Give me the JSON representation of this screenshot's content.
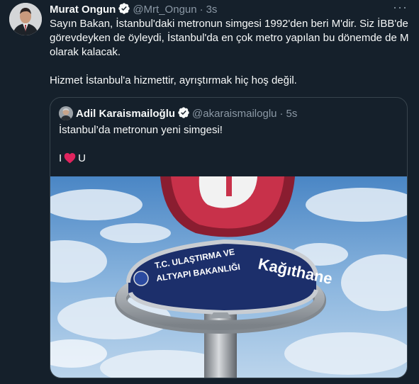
{
  "tweet": {
    "author_name": "Murat Ongun",
    "handle": "@Mrt_Ongun",
    "separator": "·",
    "time": "3s",
    "more_label": "···",
    "paragraphs": [
      "Sayın Bakan, İstanbul'daki metronun simgesi 1992'den beri M'dir. Siz İBB'de görevdeyken de öyleydi, İstanbul'da en çok metro yapılan bu dönemde de M olarak kalacak.",
      "Hizmet İstanbul'a hizmettir, ayrıştırmak hiç hoş değil."
    ]
  },
  "quoted": {
    "author_name": "Adil Karaismailoğlu",
    "handle": "@akaraismailoglu",
    "separator": "·",
    "time": "5s",
    "line1": "İstanbul’da metronun yeni simgesi!",
    "love_before": "I",
    "love_after": "U",
    "image": {
      "sign_line1": "T.C. ULAŞTIRMA VE",
      "sign_line2": "ALTYAPI BAKANLIĞI",
      "station_name": "Kağıthane"
    }
  },
  "colors": {
    "background": "#15202b",
    "text": "#f7f9f9",
    "muted": "#8b98a5",
    "verified": "#1d9bf0",
    "heart": "#e0245e"
  },
  "icons": {
    "verified": "verified-badge-icon",
    "heart": "red-heart-icon",
    "more": "more-options-icon"
  }
}
